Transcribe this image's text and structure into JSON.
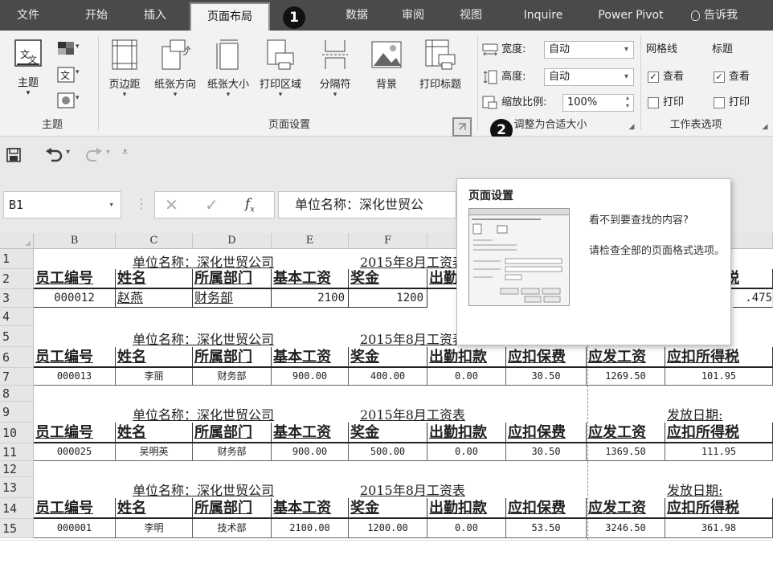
{
  "tabs": [
    {
      "label": "文件"
    },
    {
      "label": "开始"
    },
    {
      "label": "插入"
    },
    {
      "label": "页面布局"
    },
    {
      "label": "数据"
    },
    {
      "label": "审阅"
    },
    {
      "label": "视图"
    },
    {
      "label": "Inquire"
    },
    {
      "label": "Power Pivot"
    },
    {
      "label": "告诉我"
    }
  ],
  "callouts": [
    "1",
    "2"
  ],
  "ribbon": {
    "theme_group": {
      "label": "主题",
      "theme_button": "主题"
    },
    "page_setup_group": {
      "label": "页面设置",
      "buttons": [
        {
          "label": "页边距",
          "icon": "margins-icon"
        },
        {
          "label": "纸张方向",
          "icon": "orientation-icon"
        },
        {
          "label": "纸张大小",
          "icon": "paper-size-icon"
        },
        {
          "label": "打印区域",
          "icon": "print-area-icon"
        },
        {
          "label": "分隔符",
          "icon": "breaks-icon"
        },
        {
          "label": "背景",
          "icon": "background-icon"
        },
        {
          "label": "打印标题",
          "icon": "print-titles-icon"
        }
      ]
    },
    "scale_group": {
      "label": "调整为合适大小",
      "width_label": "宽度:",
      "width_value": "自动",
      "height_label": "高度:",
      "height_value": "自动",
      "scale_label": "缩放比例:",
      "scale_value": "100%"
    },
    "sheet_options_group": {
      "label": "工作表选项",
      "gridlines": "网格线",
      "headings": "标题",
      "view": "查看",
      "print": "打印"
    }
  },
  "namebox": {
    "value": "B1"
  },
  "formula": {
    "value": "单位名称：深化世贸公"
  },
  "tooltip": {
    "title": "页面设置",
    "line1": "看不到要查找的内容?",
    "line2": "请检查全部的页面格式选项。"
  },
  "sheet": {
    "columns": [
      "B",
      "C",
      "D",
      "E",
      "F"
    ],
    "row_numbers": [
      "1",
      "2",
      "3",
      "4",
      "5",
      "6",
      "7",
      "8",
      "9",
      "10",
      "11",
      "12",
      "13",
      "14",
      "15"
    ],
    "company": "单位名称：深化世贸公司",
    "title": "2015年8月工资表",
    "release_label": "发放日期:",
    "headers": [
      "员工编号",
      "姓名",
      "所属部门",
      "基本工资",
      "奖金",
      "出勤扣款",
      "应扣保费",
      "应发工资",
      "应扣所得税"
    ],
    "record1": [
      "000012",
      "赵燕",
      "财务部",
      "2100",
      "1200",
      ".475"
    ],
    "records": [
      [
        "000013",
        "李丽",
        "财务部",
        "900.00",
        "400.00",
        "0.00",
        "30.50",
        "1269.50",
        "101.95"
      ],
      [
        "000025",
        "吴明英",
        "财务部",
        "900.00",
        "500.00",
        "0.00",
        "30.50",
        "1369.50",
        "111.95"
      ],
      [
        "000001",
        "李明",
        "技术部",
        "2100.00",
        "1200.00",
        "0.00",
        "53.50",
        "3246.50",
        "361.98"
      ]
    ]
  }
}
